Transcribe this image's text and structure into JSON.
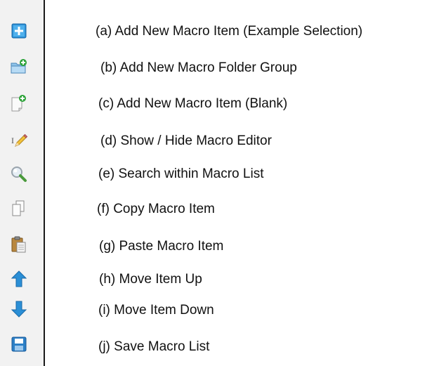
{
  "toolbar": {
    "items": [
      {
        "id": "a",
        "icon": "add-item-icon",
        "label": "(a) Add New Macro Item (Example Selection)"
      },
      {
        "id": "b",
        "icon": "add-folder-icon",
        "label": "(b) Add New Macro Folder Group"
      },
      {
        "id": "c",
        "icon": "add-blank-item-icon",
        "label": "(c) Add New Macro Item (Blank)"
      },
      {
        "id": "d",
        "icon": "editor-pencil-icon",
        "label": "(d) Show / Hide Macro Editor"
      },
      {
        "id": "e",
        "icon": "search-icon",
        "label": "(e) Search within Macro List"
      },
      {
        "id": "f",
        "icon": "copy-icon",
        "label": "(f) Copy Macro Item"
      },
      {
        "id": "g",
        "icon": "paste-icon",
        "label": "(g) Paste Macro Item"
      },
      {
        "id": "h",
        "icon": "arrow-up-icon",
        "label": "(h) Move Item Up"
      },
      {
        "id": "i",
        "icon": "arrow-down-icon",
        "label": "(i) Move Item Down"
      },
      {
        "id": "j",
        "icon": "save-icon",
        "label": "(j) Save Macro List"
      }
    ]
  },
  "colors": {
    "toolbar_bg": "#f2f2f2",
    "accent_blue": "#2b8fd6",
    "add_green": "#2ea43a",
    "label_text": "#111111"
  }
}
